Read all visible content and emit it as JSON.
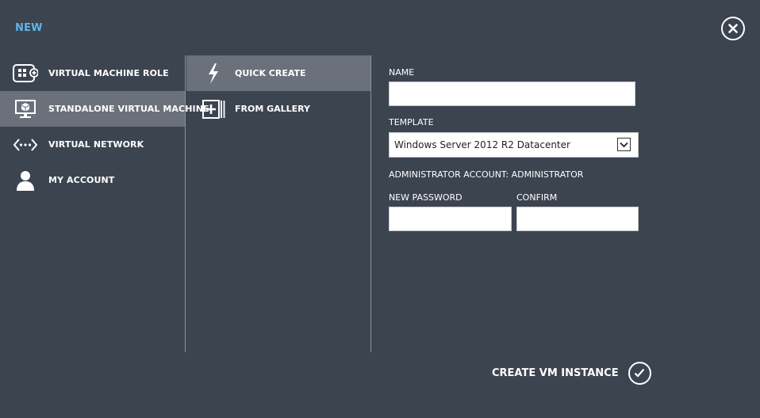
{
  "header": {
    "title": "NEW"
  },
  "nav": {
    "items": [
      {
        "label": "VIRTUAL MACHINE ROLE",
        "icon": "vm-role-icon"
      },
      {
        "label": "STANDALONE VIRTUAL MACHINE",
        "icon": "monitor-icon",
        "selected": true
      },
      {
        "label": "VIRTUAL NETWORK",
        "icon": "network-icon"
      },
      {
        "label": "MY ACCOUNT",
        "icon": "user-icon"
      }
    ]
  },
  "sub_nav": {
    "items": [
      {
        "label": "QUICK CREATE",
        "icon": "lightning-icon",
        "selected": true
      },
      {
        "label": "FROM GALLERY",
        "icon": "gallery-add-icon"
      }
    ]
  },
  "form": {
    "name_label": "NAME",
    "name_value": "",
    "template_label": "TEMPLATE",
    "template_value": "Windows Server 2012 R2 Datacenter",
    "admin_account_text": "ADMINISTRATOR ACCOUNT: ADMINISTRATOR",
    "password_label": "NEW PASSWORD",
    "password_value": "",
    "confirm_label": "CONFIRM",
    "confirm_value": ""
  },
  "footer": {
    "create_label": "CREATE VM INSTANCE"
  },
  "colors": {
    "background": "#3c4450",
    "selected": "#6b717b",
    "accent": "#5fb4e6"
  }
}
